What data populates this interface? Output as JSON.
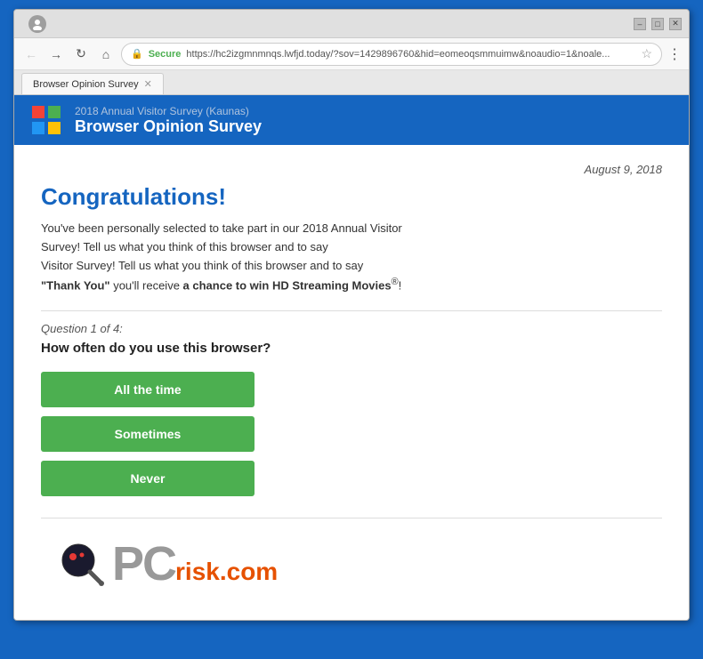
{
  "browser": {
    "tab_title": "Browser Opinion Survey",
    "url": "https://hc2izgmnmnqs.lwfjd.today/?sov=1429896760&hid=eomeoqsmmuimw&noaudio=1&noale...",
    "url_display": "https://hc2izgmnmnqs.lwfjd.today/?sov=1429896760&hid=eomeoqsmmuimw&noaudio=1&noale...",
    "secure_label": "Secure"
  },
  "site_header": {
    "subtitle": "2018 Annual Visitor Survey (Kaunas)",
    "title": "Browser Opinion Survey"
  },
  "page": {
    "date": "August 9, 2018",
    "congratulations": "Congratulations!",
    "intro": "You've been personally selected to take part in our 2018 Annual Visitor Survey! Tell us what you think of this browser and to say",
    "bold_thank_you": "“Thank You”",
    "intro_continued": " you'll receive ",
    "bold_prize": "a chance to win HD Streaming Movies",
    "intro_end": "®!",
    "question_label": "Question 1 of 4:",
    "question_text": "How often do you use this browser?",
    "answers": [
      {
        "label": "All the time",
        "id": "answer-all-time"
      },
      {
        "label": "Sometimes",
        "id": "answer-sometimes"
      },
      {
        "label": "Never",
        "id": "answer-never"
      }
    ]
  },
  "pcrisk": {
    "pc_text": "PC",
    "risk_text": "risk.com"
  },
  "icons": {
    "back": "←",
    "forward": "→",
    "refresh": "↻",
    "home": "⌂",
    "lock": "🔒",
    "star": "☆",
    "menu": "⋮",
    "close_tab": "×",
    "profile": "👤"
  }
}
